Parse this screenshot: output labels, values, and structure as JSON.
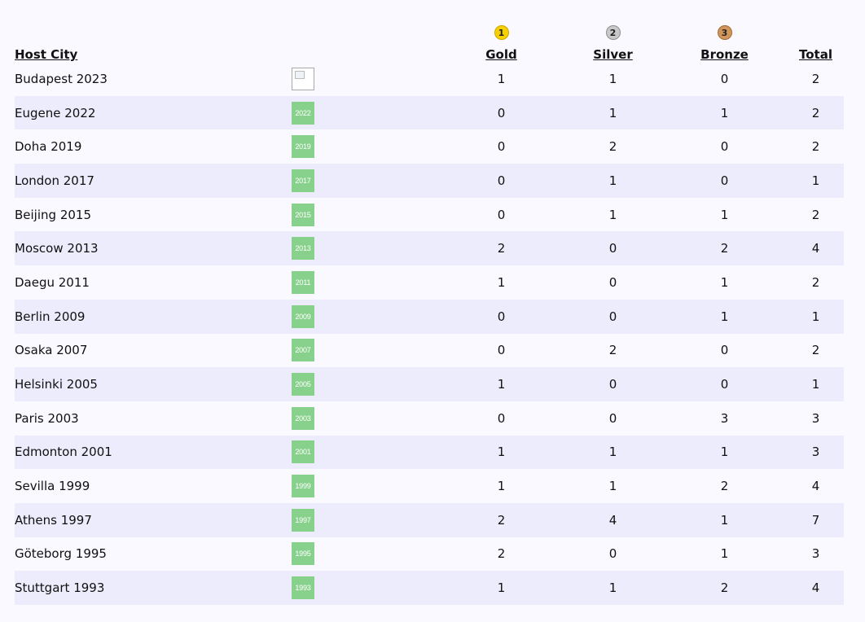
{
  "headers": {
    "host_city": "Host City",
    "gold": "Gold",
    "silver": "Silver",
    "bronze": "Bronze",
    "total": "Total"
  },
  "medal_icons": {
    "gold_rank": "1",
    "silver_rank": "2",
    "bronze_rank": "3"
  },
  "colors": {
    "gold": "#f6d000",
    "silver": "#c8c8c8",
    "bronze": "#d2955c",
    "badge": "#88d18c",
    "stripe": "#ececfc"
  },
  "rows": [
    {
      "city": "Budapest 2023",
      "badge": "",
      "gold": "1",
      "silver": "1",
      "bronze": "0",
      "total": "2"
    },
    {
      "city": "Eugene 2022",
      "badge": "2022",
      "gold": "0",
      "silver": "1",
      "bronze": "1",
      "total": "2"
    },
    {
      "city": "Doha 2019",
      "badge": "2019",
      "gold": "0",
      "silver": "2",
      "bronze": "0",
      "total": "2"
    },
    {
      "city": "London 2017",
      "badge": "2017",
      "gold": "0",
      "silver": "1",
      "bronze": "0",
      "total": "1"
    },
    {
      "city": "Beijing 2015",
      "badge": "2015",
      "gold": "0",
      "silver": "1",
      "bronze": "1",
      "total": "2"
    },
    {
      "city": "Moscow 2013",
      "badge": "2013",
      "gold": "2",
      "silver": "0",
      "bronze": "2",
      "total": "4"
    },
    {
      "city": "Daegu 2011",
      "badge": "2011",
      "gold": "1",
      "silver": "0",
      "bronze": "1",
      "total": "2"
    },
    {
      "city": "Berlin 2009",
      "badge": "2009",
      "gold": "0",
      "silver": "0",
      "bronze": "1",
      "total": "1"
    },
    {
      "city": "Osaka 2007",
      "badge": "2007",
      "gold": "0",
      "silver": "2",
      "bronze": "0",
      "total": "2"
    },
    {
      "city": "Helsinki 2005",
      "badge": "2005",
      "gold": "1",
      "silver": "0",
      "bronze": "0",
      "total": "1"
    },
    {
      "city": "Paris 2003",
      "badge": "2003",
      "gold": "0",
      "silver": "0",
      "bronze": "3",
      "total": "3"
    },
    {
      "city": "Edmonton 2001",
      "badge": "2001",
      "gold": "1",
      "silver": "1",
      "bronze": "1",
      "total": "3"
    },
    {
      "city": "Sevilla 1999",
      "badge": "1999",
      "gold": "1",
      "silver": "1",
      "bronze": "2",
      "total": "4"
    },
    {
      "city": "Athens 1997",
      "badge": "1997",
      "gold": "2",
      "silver": "4",
      "bronze": "1",
      "total": "7"
    },
    {
      "city": "Göteborg 1995",
      "badge": "1995",
      "gold": "2",
      "silver": "0",
      "bronze": "1",
      "total": "3"
    },
    {
      "city": "Stuttgart 1993",
      "badge": "1993",
      "gold": "1",
      "silver": "1",
      "bronze": "2",
      "total": "4"
    }
  ]
}
